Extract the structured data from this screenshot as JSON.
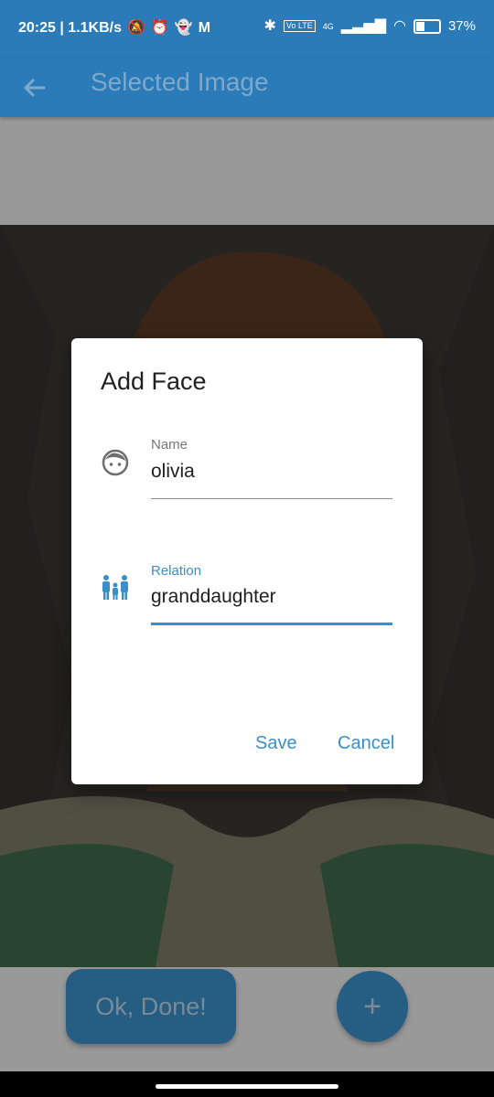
{
  "status_bar": {
    "time_speed": "20:25 | 1.1KB/s",
    "net_type": "4G",
    "volte": "Vo LTE",
    "battery": "37%"
  },
  "app_bar": {
    "title": "Selected Image"
  },
  "dialog": {
    "title": "Add Face",
    "name_field": {
      "label": "Name",
      "value": "olivia"
    },
    "relation_field": {
      "label": "Relation",
      "value": "granddaughter"
    },
    "save_label": "Save",
    "cancel_label": "Cancel"
  },
  "bottom": {
    "ok_label": "Ok, Done!",
    "fab_label": "+"
  },
  "colors": {
    "primary": "#2a7bb8",
    "accent": "#3b8fc8"
  }
}
